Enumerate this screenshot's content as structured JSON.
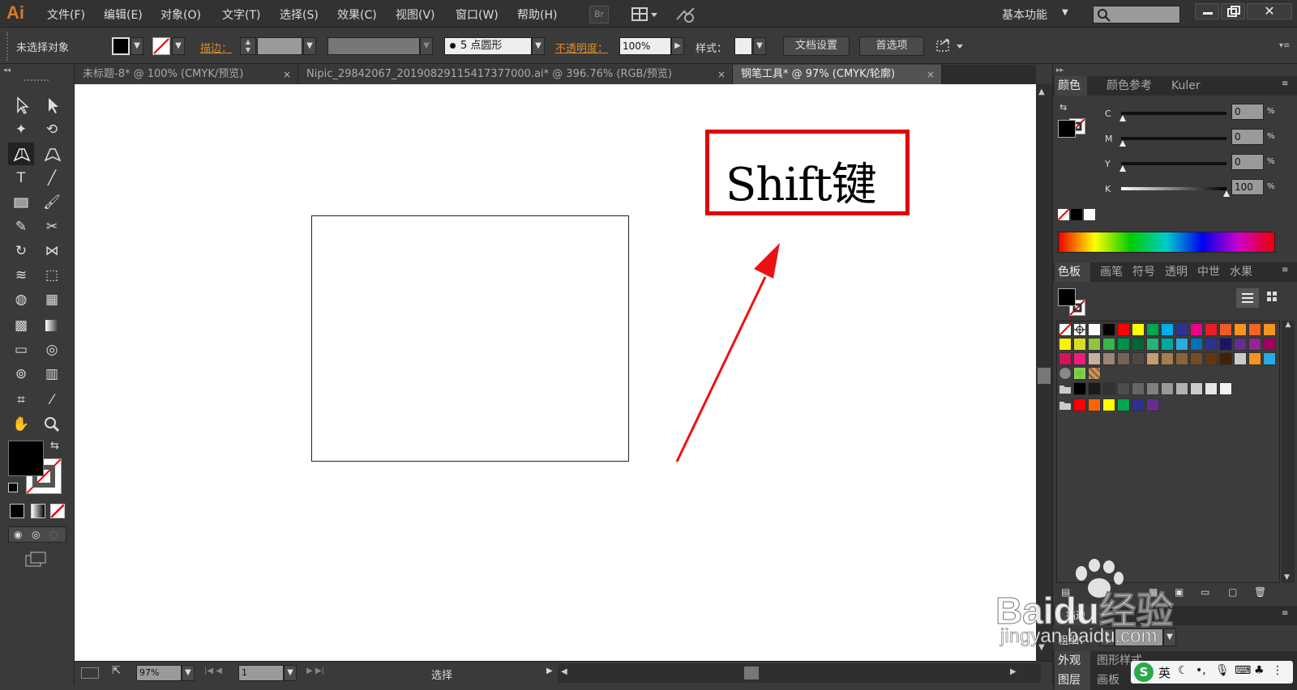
{
  "app": {
    "logo": "Ai",
    "workspace": "基本功能",
    "bridge": "Br"
  },
  "menu": [
    "文件(F)",
    "编辑(E)",
    "对象(O)",
    "文字(T)",
    "选择(S)",
    "效果(C)",
    "视图(V)",
    "窗口(W)",
    "帮助(H)"
  ],
  "control": {
    "selection": "未选择对象",
    "stroke_label": "描边：",
    "brush": "5 点圆形",
    "opacity_label": "不透明度：",
    "opacity": "100%",
    "style_label": "样式：",
    "doc_settings": "文档设置",
    "prefs": "首选项"
  },
  "tabs": [
    {
      "label": "未标题-8* @ 100% (CMYK/预览)",
      "active": false
    },
    {
      "label": "Nipic_29842067_20190829115417377000.ai* @ 396.76% (RGB/预览)",
      "active": false
    },
    {
      "label": "钢笔工具* @ 97% (CMYK/轮廓)",
      "active": true
    }
  ],
  "tab_close": "×",
  "annotation": {
    "text": "Shift键",
    "border_color": "#e00000",
    "arrow_color": "#ee1111"
  },
  "status": {
    "zoom": "97%",
    "page": "1",
    "mode": "选择"
  },
  "color_panel": {
    "tabs": [
      "颜色",
      "颜色参考",
      "Kuler"
    ],
    "channels": [
      {
        "name": "C",
        "value": "0"
      },
      {
        "name": "M",
        "value": "0"
      },
      {
        "name": "Y",
        "value": "0"
      },
      {
        "name": "K",
        "value": "100"
      }
    ],
    "unit": "%"
  },
  "swatch_panel": {
    "tabs": [
      "色板",
      "画笔",
      "符号",
      "透明",
      "中世",
      "水果"
    ],
    "row1": [
      "#ffffff",
      "#000000",
      "#ff0000",
      "#ffff00",
      "#00a651",
      "#00aeef",
      "#2e3192",
      "#ec008c",
      "#ed1c24",
      "#f15a24",
      "#f7941d",
      "#f26522",
      "#f7941d"
    ],
    "row2": [
      "#fff200",
      "#d7df23",
      "#8dc63f",
      "#39b54a",
      "#009245",
      "#006837",
      "#22b573",
      "#00a99d",
      "#29abe2",
      "#0071bc",
      "#2e3192",
      "#1b1464",
      "#662d91",
      "#93278f",
      "#9e005d"
    ],
    "row3": [
      "#d4145a",
      "#ed1e79",
      "#c7b299",
      "#998675",
      "#736357",
      "#534741",
      "#c69c6d",
      "#a67c52",
      "#8c6239",
      "#754c24",
      "#603813",
      "#42210b",
      "#cccccc",
      "#f7941d",
      "#29abe2"
    ],
    "gray": [
      "#000000",
      "#1a1a1a",
      "#333333",
      "#4d4d4d",
      "#666666",
      "#808080",
      "#999999",
      "#b3b3b3",
      "#cccccc",
      "#e6e6e6",
      "#f2f2f2"
    ],
    "group": [
      "#ff0000",
      "#ff6600",
      "#ffff00",
      "#00a651",
      "#2e3192",
      "#662d91"
    ]
  },
  "stroke_panel": {
    "tab": "描边",
    "weight_label": "粗细："
  },
  "bottom_tabs": [
    "外观",
    "图形样式"
  ],
  "layers_tabs": [
    "图层",
    "画板"
  ],
  "watermark": {
    "brand": "Baidu经验",
    "url": "jingyan.baidu.com"
  },
  "ime": {
    "lang": "英"
  }
}
